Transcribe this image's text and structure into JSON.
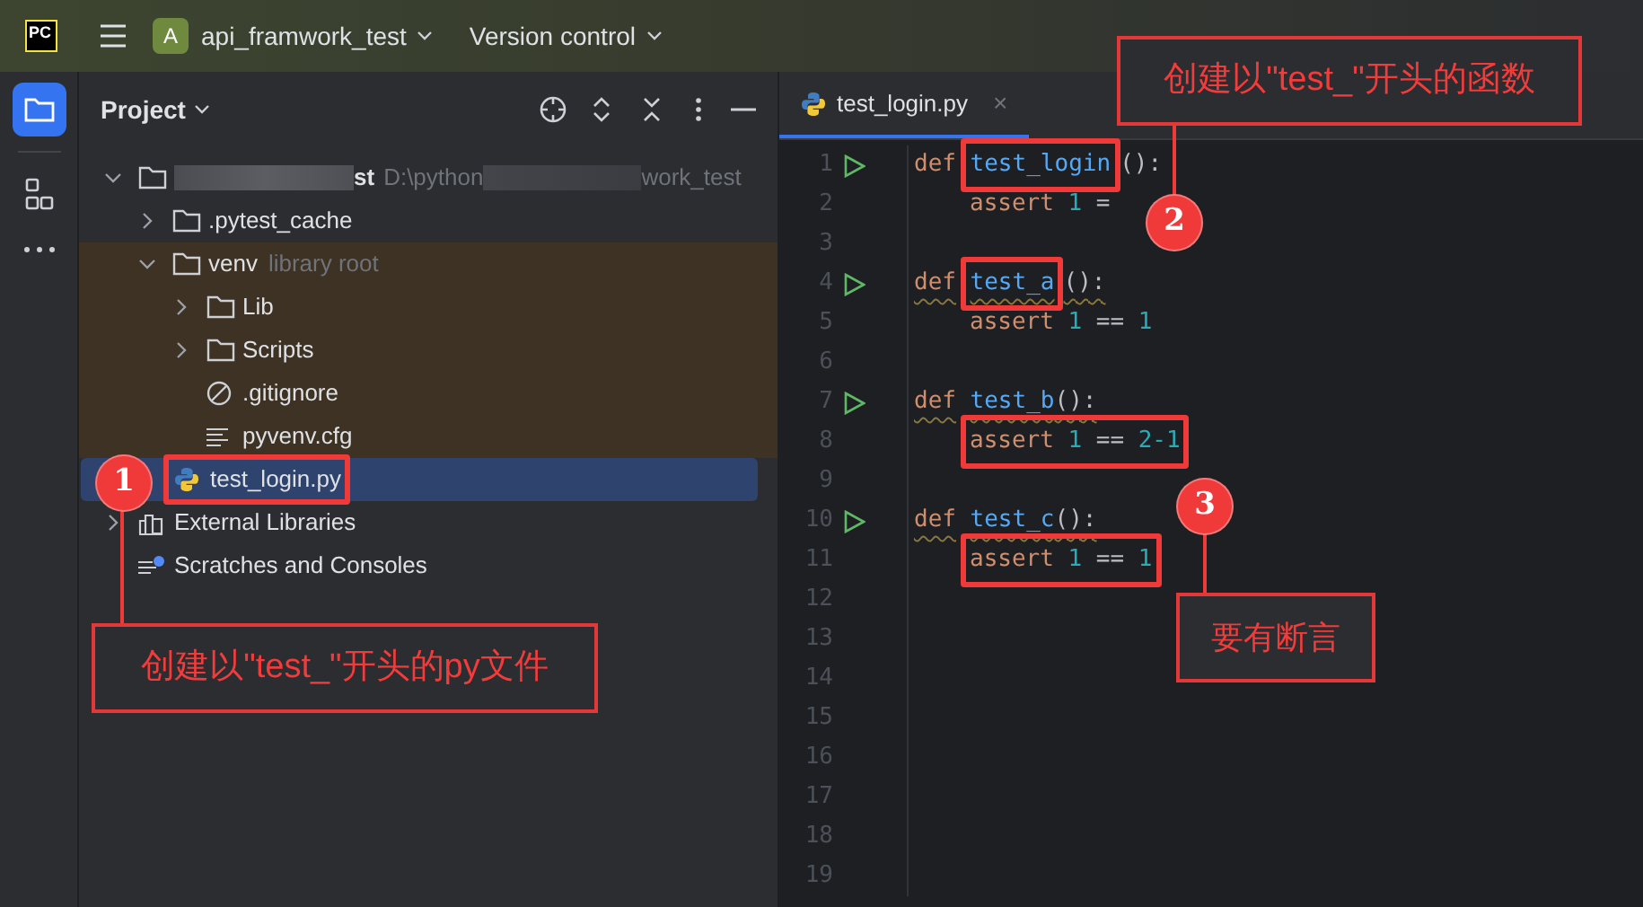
{
  "title_bar": {
    "logo": "PC",
    "project_badge": "A",
    "project_name": "api_framwork_test",
    "vcs": "Version control"
  },
  "project_panel": {
    "title": "Project",
    "tree": [
      {
        "kind": "folder",
        "name": "st",
        "path_start": "D:\\python",
        "path_end": "work_test",
        "redacted": true,
        "expanded": true,
        "selected": false,
        "highlight": false,
        "children": [
          {
            "kind": "folder",
            "name": ".pytest_cache",
            "expanded": false,
            "selected": false,
            "highlight": false
          },
          {
            "kind": "folder",
            "name": "venv",
            "hint": "library root",
            "excluded": true,
            "expanded": true,
            "selected": false,
            "highlight": false,
            "children": [
              {
                "kind": "folder",
                "name": "Lib",
                "expanded": false,
                "selected": false,
                "excluded": true,
                "highlight": false
              },
              {
                "kind": "folder",
                "name": "Scripts",
                "expanded": false,
                "selected": false,
                "excluded": true,
                "highlight": false
              },
              {
                "kind": "ignore",
                "name": ".gitignore",
                "selected": false,
                "excluded": true,
                "highlight": false
              },
              {
                "kind": "text",
                "name": "pyvenv.cfg",
                "selected": false,
                "excluded": true,
                "highlight": false
              }
            ]
          },
          {
            "kind": "python",
            "name": "test_login.py",
            "selected": true,
            "highlight": true
          }
        ]
      },
      {
        "kind": "libraries",
        "name": "External Libraries",
        "expanded": false,
        "selected": false,
        "highlight": false
      },
      {
        "kind": "scratches",
        "name": "Scratches and Consoles",
        "selected": false,
        "highlight": false
      }
    ]
  },
  "editor": {
    "tab": {
      "label": "test_login.py",
      "close": "×",
      "selected": true
    },
    "lines": [
      {
        "number": "1",
        "run": true,
        "warning": false,
        "indented": false,
        "framed": false,
        "tokens": [
          {
            "kind": "keyword",
            "text": "def",
            "highlight": false
          },
          {
            "kind": "func",
            "text": "test_login",
            "highlight": true
          },
          {
            "kind": "plain",
            "text": "():",
            "highlight": false
          }
        ]
      },
      {
        "number": "2",
        "run": false,
        "warning": false,
        "indented": true,
        "framed": false,
        "tokens": [
          {
            "kind": "keyword",
            "text": "assert"
          },
          {
            "kind": "number",
            "text": "1"
          },
          {
            "kind": "plain",
            "text": "="
          }
        ]
      },
      {
        "number": "3",
        "run": false,
        "warning": false
      },
      {
        "number": "4",
        "run": true,
        "warning": true,
        "indented": false,
        "framed": false,
        "tokens": [
          {
            "kind": "keyword",
            "text": "def",
            "highlight": false
          },
          {
            "kind": "func",
            "text": "test_a",
            "highlight": true
          },
          {
            "kind": "plain",
            "text": "():",
            "highlight": false
          }
        ]
      },
      {
        "number": "5",
        "run": false,
        "warning": false,
        "indented": true,
        "framed": false,
        "tokens": [
          {
            "kind": "keyword",
            "text": "assert"
          },
          {
            "kind": "number",
            "text": "1"
          },
          {
            "kind": "plain",
            "text": "=="
          },
          {
            "kind": "number",
            "text": "1"
          }
        ]
      },
      {
        "number": "6",
        "run": false,
        "warning": false
      },
      {
        "number": "7",
        "run": true,
        "warning": true,
        "indented": false,
        "framed": false,
        "tokens": [
          {
            "kind": "keyword",
            "text": "def",
            "highlight": false
          },
          {
            "kind": "func",
            "text": "test_b",
            "highlight": false
          },
          {
            "kind": "plain",
            "text": "():",
            "highlight": false
          }
        ]
      },
      {
        "number": "8",
        "run": false,
        "warning": false,
        "indented": true,
        "framed": true,
        "tokens": [
          {
            "kind": "keyword",
            "text": "assert"
          },
          {
            "kind": "number",
            "text": "1"
          },
          {
            "kind": "plain",
            "text": "=="
          },
          {
            "kind": "number",
            "text": "2-1"
          }
        ]
      },
      {
        "number": "9",
        "run": false,
        "warning": false
      },
      {
        "number": "10",
        "run": true,
        "warning": true,
        "indented": false,
        "framed": false,
        "tokens": [
          {
            "kind": "keyword",
            "text": "def",
            "highlight": false
          },
          {
            "kind": "func",
            "text": "test_c",
            "highlight": false
          },
          {
            "kind": "plain",
            "text": "():",
            "highlight": false
          }
        ]
      },
      {
        "number": "11",
        "run": false,
        "warning": false,
        "indented": true,
        "framed": true,
        "tokens": [
          {
            "kind": "keyword",
            "text": "assert"
          },
          {
            "kind": "number",
            "text": "1"
          },
          {
            "kind": "plain",
            "text": "=="
          },
          {
            "kind": "number",
            "text": "1"
          }
        ]
      },
      {
        "number": "12",
        "run": false,
        "warning": false
      },
      {
        "number": "13",
        "run": false,
        "warning": false
      },
      {
        "number": "14",
        "run": false,
        "warning": false
      },
      {
        "number": "15",
        "run": false,
        "warning": false
      },
      {
        "number": "16",
        "run": false,
        "warning": false
      },
      {
        "number": "17",
        "run": false,
        "warning": false
      },
      {
        "number": "18",
        "run": false,
        "warning": false
      },
      {
        "number": "19",
        "run": false,
        "warning": false
      }
    ]
  },
  "annotations": [
    {
      "number": "1",
      "text": "创建以\"test_\"开头的py文件"
    },
    {
      "number": "2",
      "text": "创建以\"test_\"开头的函数"
    },
    {
      "number": "3",
      "text": "要有断言"
    }
  ]
}
